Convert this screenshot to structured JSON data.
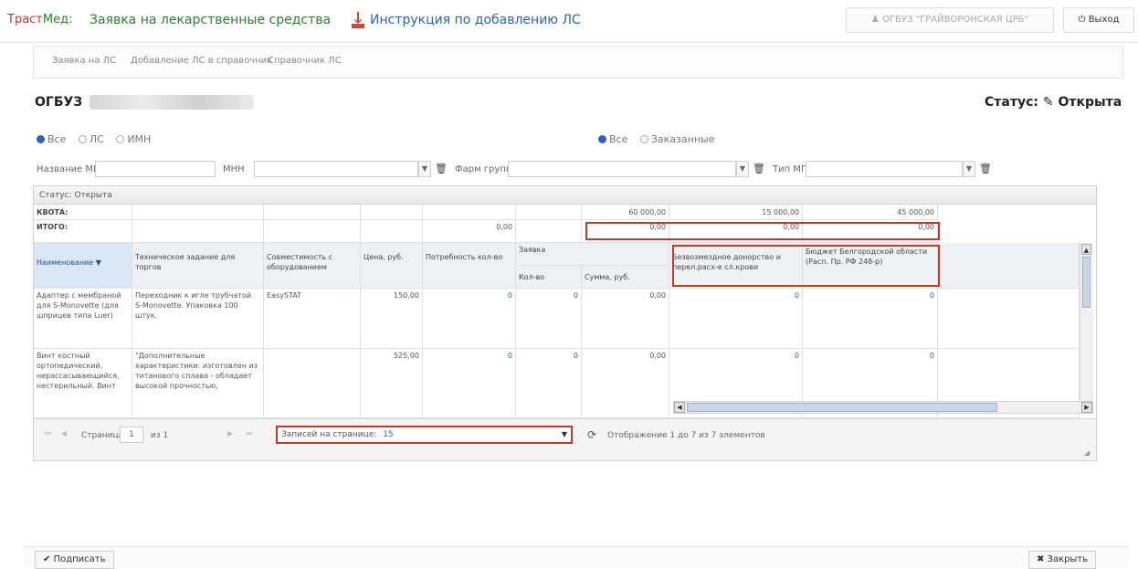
{
  "header": {
    "brand_part1": "Траст",
    "brand_part2": "Мед:",
    "app_title": "Заявка на лекарственные средства",
    "instruction_link": "Инструкция по добавлению ЛС",
    "user_label": "ОГБУЗ \"ГРАЙВОРОНСКАЯ ЦРБ\"",
    "logout_label": "Выход"
  },
  "subnav": {
    "items": [
      "Заявка на ЛС",
      "Добавление ЛС в справочник",
      "Справочник ЛС"
    ]
  },
  "org": {
    "prefix": "ОГБУЗ",
    "status_label": "Статус:",
    "status_value": "Открыта"
  },
  "filters": {
    "type_radios": [
      "Все",
      "ЛС",
      "ИМН"
    ],
    "order_radios": [
      "Все",
      "Заказанные"
    ],
    "name_label": "Название МП",
    "mnn_label": "МНН",
    "pharm_label": "Фарм группа",
    "type_label": "Тип МП"
  },
  "grid": {
    "caption": "Статус: Открыта",
    "kvota_label": "КВОТА:",
    "itogo_label": "ИТОГО:",
    "kvota_values": [
      "60 000,00",
      "15 000,00",
      "45 000,00"
    ],
    "itogo_values": [
      "0,00",
      "0,00",
      "0,00",
      "0,00"
    ],
    "headers": {
      "name": "Наименование",
      "task": "Техническое задание для торгов",
      "compat": "Совместимость с оборудованием",
      "price": "Цена, руб.",
      "need": "Потребность кол-во",
      "order": "Заявка",
      "qty": "Кол-во",
      "sum": "Сумма, руб.",
      "budget1": "Безвозмездное донорство и перел.расх-е сл.крови",
      "budget2": "Бюджет Белгородской области (Расп. Пр. РФ 248-р)"
    },
    "rows": [
      {
        "name": "Адаптер с мембраной для S-Monovette (для шприцев типа Luer)",
        "task": "Переходник к игле трубчатой S-Monovette. Упаковка 100 штук.",
        "compat": "EasySTAT",
        "price": "150,00",
        "need": "0",
        "qty": "0",
        "sum": "0,00",
        "b1": "0",
        "b2": "0"
      },
      {
        "name": "Винт костный ортопедический, нерассасывающийся, нестерильный. Винт",
        "task": "\"Дополнительные характеристики: изготовлен из титанового сплава - обладает высокой прочностью,",
        "compat": "",
        "price": "525,00",
        "need": "0",
        "qty": "0",
        "sum": "0,00",
        "b1": "0",
        "b2": "0"
      }
    ]
  },
  "pager": {
    "page_label": "Страница",
    "page_value": "1",
    "of_label": "из 1",
    "rpp_label": "Записей на странице:",
    "rpp_value": "15",
    "display_text": "Отображение 1 до 7 из 7 элементов"
  },
  "footer": {
    "sign_label": "Подписать",
    "close_label": "Закрыть"
  }
}
